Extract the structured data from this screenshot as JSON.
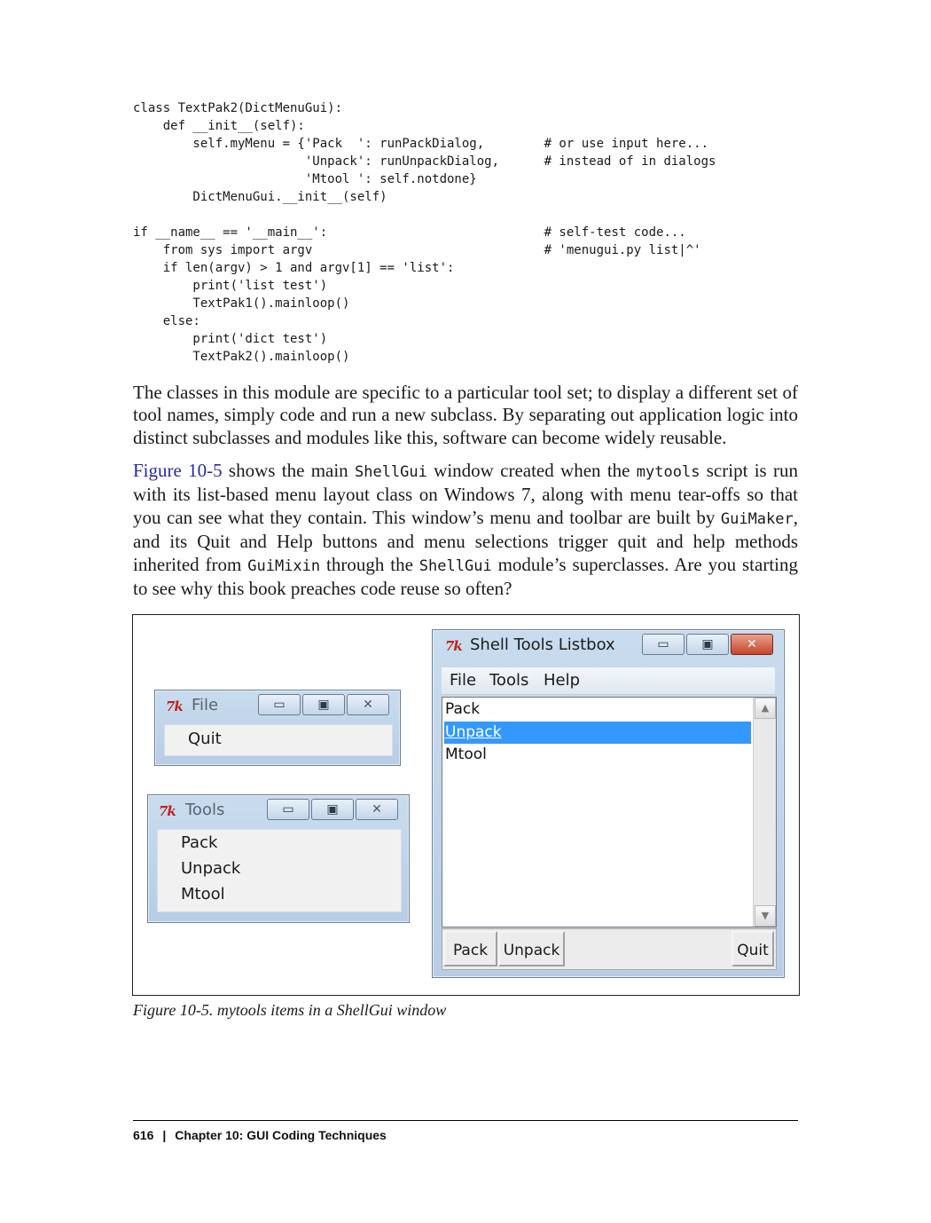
{
  "code_block": "class TextPak2(DictMenuGui):\n    def __init__(self):\n        self.myMenu = {'Pack  ': runPackDialog,        # or use input here...\n                       'Unpack': runUnpackDialog,      # instead of in dialogs\n                       'Mtool ': self.notdone}\n        DictMenuGui.__init__(self)\n\nif __name__ == '__main__':                             # self-test code...\n    from sys import argv                               # 'menugui.py list|^'\n    if len(argv) > 1 and argv[1] == 'list':\n        print('list test')\n        TextPak1().mainloop()\n    else:\n        print('dict test')\n        TextPak2().mainloop()",
  "paragraph1": "The classes in this module are specific to a particular tool set; to display a different set of tool names, simply code and run a new subclass. By separating out application logic into distinct subclasses and modules like this, software can become widely reusable.",
  "paragraph2": {
    "link": "Figure 10-5",
    "t1": " shows the main ",
    "c1": "ShellGui",
    "t2": " window created when the ",
    "c2": "mytools",
    "t3": " script is run with its list-based menu layout class on Windows 7, along with menu tear-offs so that you can see what they contain. This window’s menu and toolbar are built by ",
    "c3": "GuiMaker",
    "t4": ", and its Quit and Help buttons and menu selections trigger quit and help methods inherited from ",
    "c4": "GuiMixin",
    "t5": " through the ",
    "c5": "ShellGui",
    "t6": " module’s superclasses. Are you starting to see why this book preaches code reuse so often?"
  },
  "figure": {
    "tk_logo": "7k",
    "file_tearoff": {
      "title": "File",
      "items": [
        "Quit"
      ]
    },
    "tools_tearoff": {
      "title": "Tools",
      "items": [
        "Pack",
        "Unpack",
        "Mtool"
      ]
    },
    "main_window": {
      "title": "Shell Tools Listbox",
      "menu": [
        "File",
        "Tools",
        "Help"
      ],
      "list_items": [
        "Pack",
        "Unpack",
        "Mtool"
      ],
      "selected_index": 1,
      "toolbar_buttons": [
        "Pack",
        "Unpack",
        "Quit"
      ]
    },
    "window_controls": {
      "minimize": "▭",
      "maximize": "▣",
      "close": "✕"
    },
    "scroll_up": "▲",
    "scroll_down": "▼",
    "selection_color": "#3399ff",
    "close_button_color": "#c6442a"
  },
  "caption": "Figure 10-5. mytools items in a ShellGui window",
  "footer": {
    "page_number": "616",
    "separator": "|",
    "chapter": "Chapter 10:  GUI Coding Techniques"
  }
}
